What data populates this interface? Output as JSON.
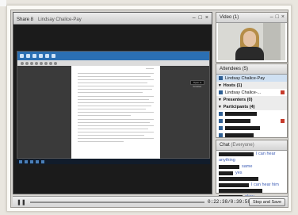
{
  "share": {
    "title": "Share 8",
    "presenter": "Lindsay Chalice-Pay",
    "controls": [
      "–",
      "□",
      "×"
    ],
    "doc_button": "Open in browser"
  },
  "video": {
    "title": "Video",
    "count": "(1)",
    "controls": [
      "–",
      "□",
      "×"
    ]
  },
  "attendees": {
    "title": "Attendees",
    "count": "(5)",
    "selected": "Lindsay Chalice-Pay",
    "hosts_label": "Hosts (1)",
    "host_name": "Lindsay Chalice-...",
    "presenters_label": "Presenters (0)",
    "participants_label": "Participants (4)"
  },
  "chat": {
    "title": "Chat",
    "scope": "(Everyone)",
    "messages": [
      {
        "text": "I can hear"
      },
      {
        "text": "anything"
      },
      {
        "text": "same"
      },
      {
        "text": "yes"
      },
      {
        "text": ""
      },
      {
        "text": "I can hear him"
      },
      {
        "text": ""
      },
      {
        "text": "okay"
      }
    ]
  },
  "bottom": {
    "pause_icon": "pause-icon",
    "time": "0:22:38/0:39:58",
    "stop_label": "Stop and Save"
  },
  "colors": {
    "accent": "#2b6fb3",
    "chat_text": "#3b5bb5",
    "redaction": "#1e1e1e"
  }
}
